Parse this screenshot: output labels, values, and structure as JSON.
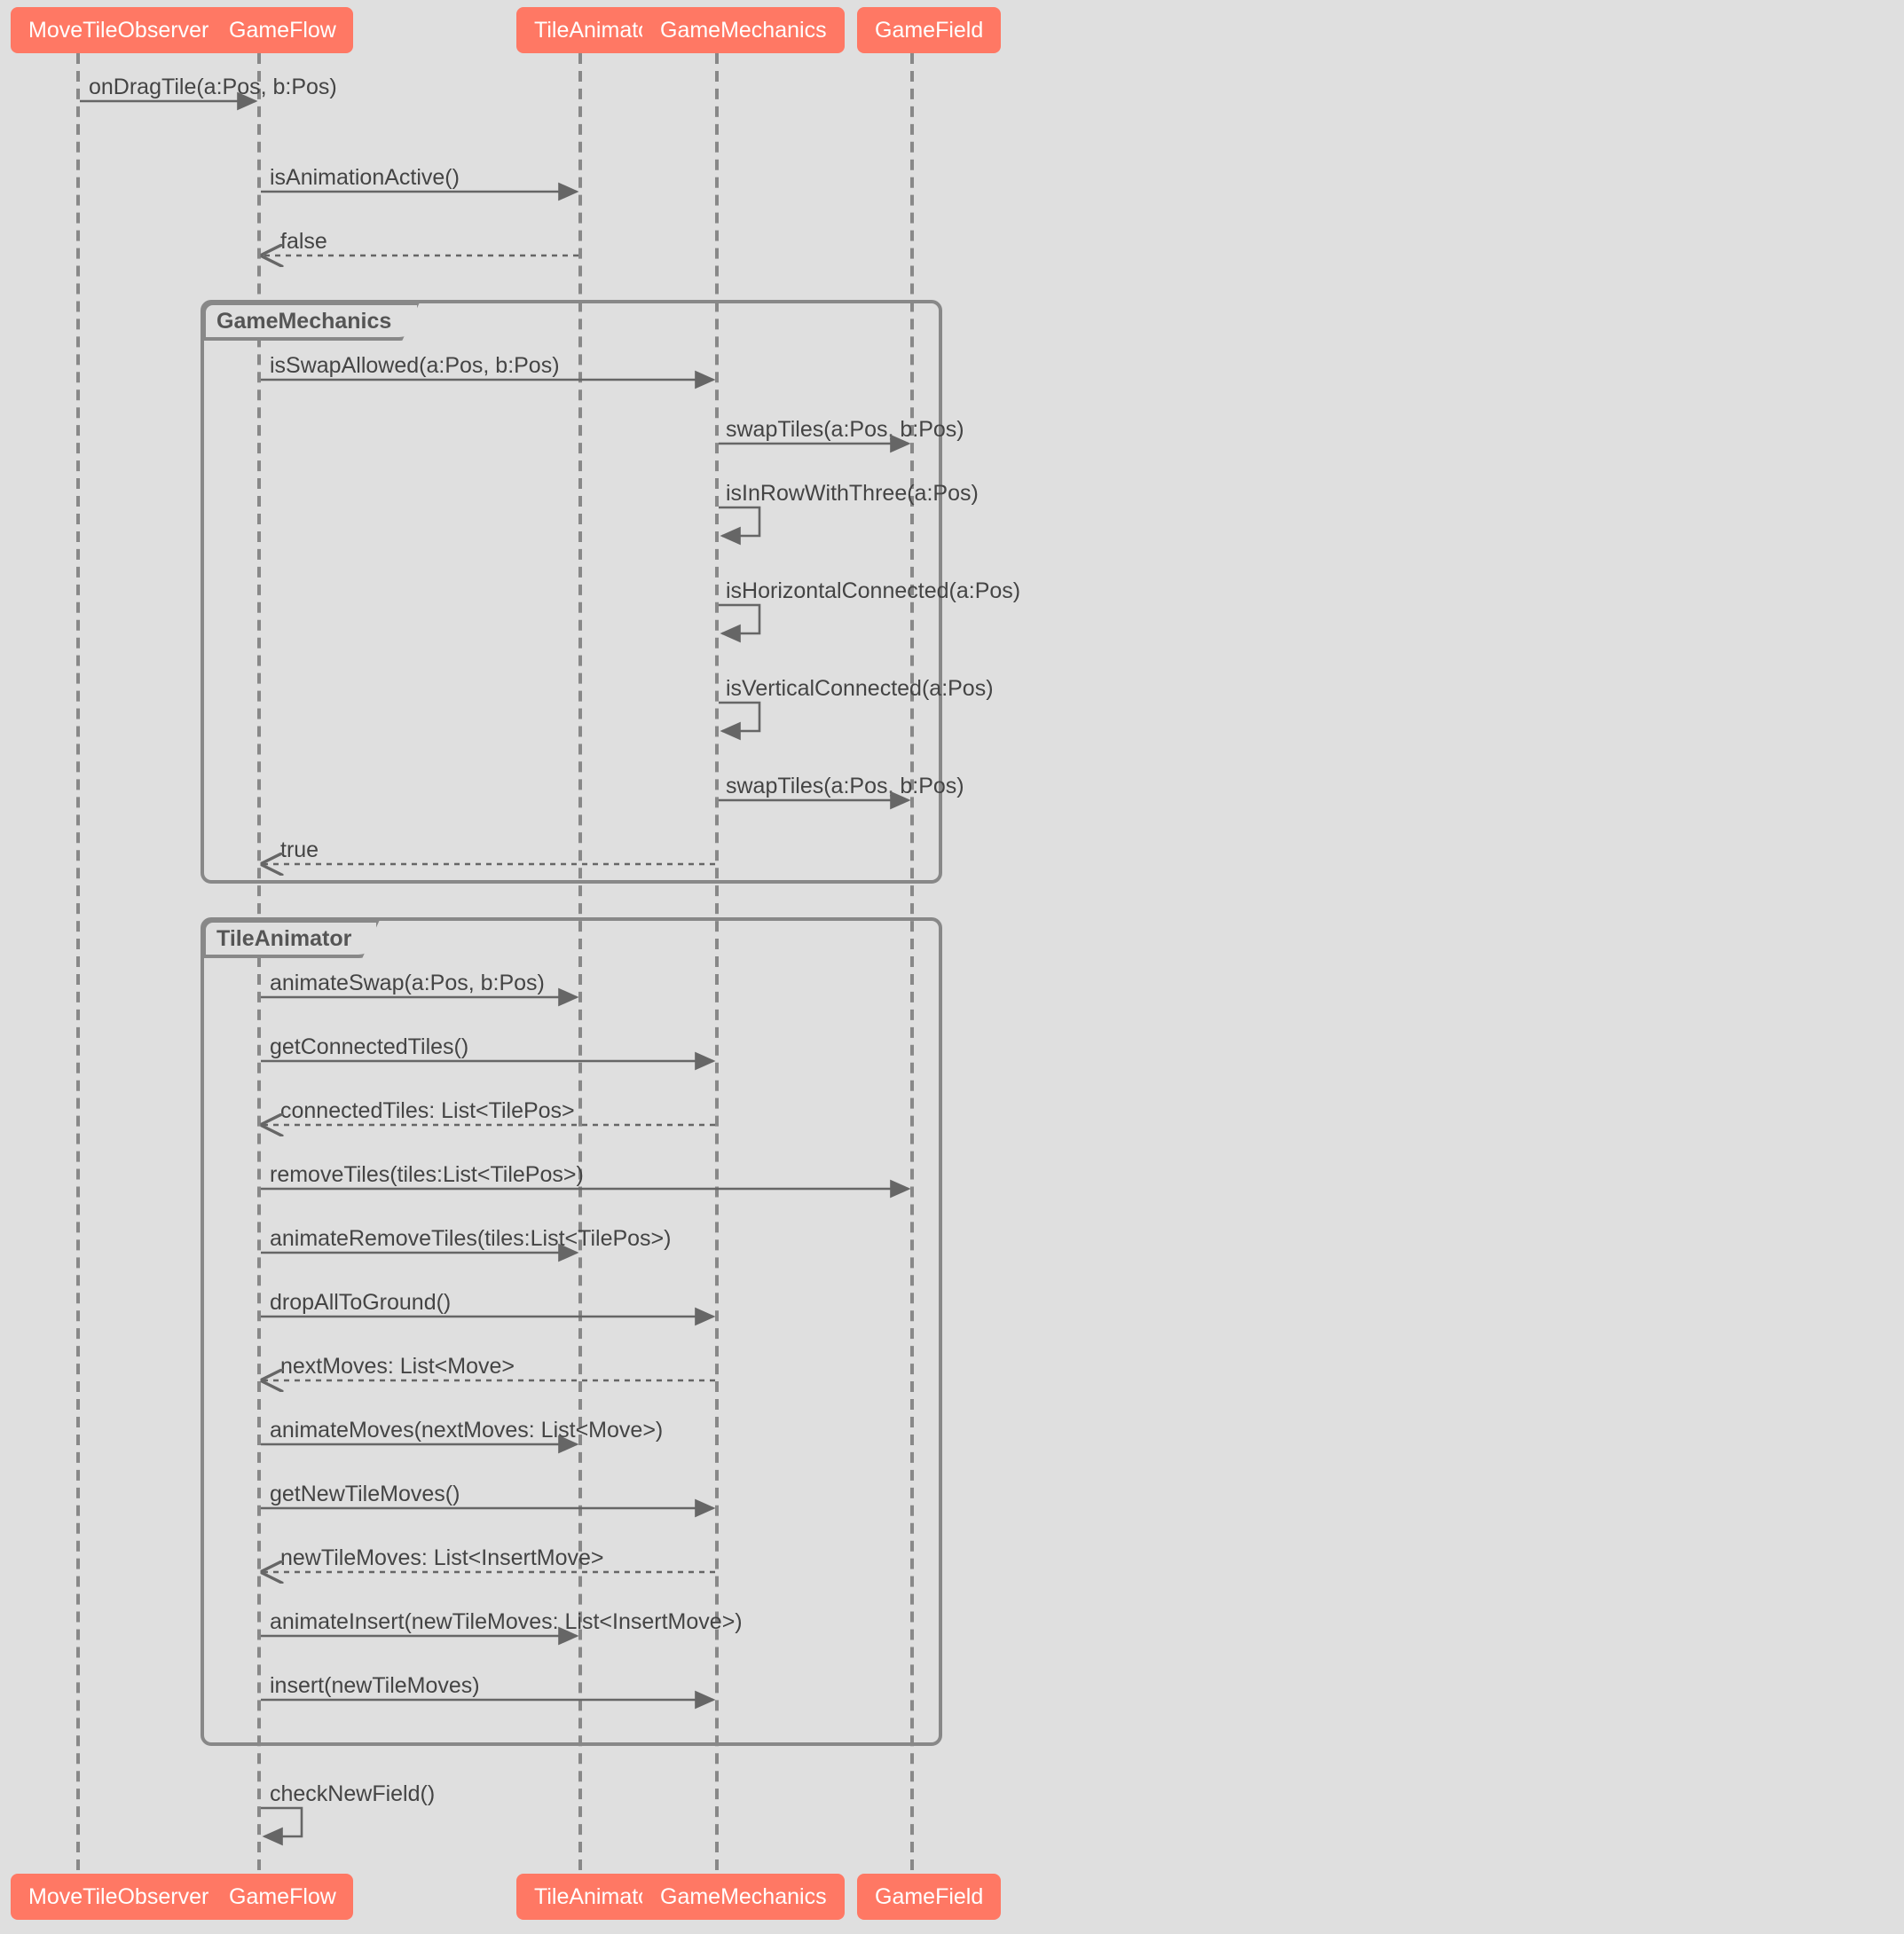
{
  "participants": {
    "p0": "MoveTileObserver",
    "p1": "GameFlow",
    "p2": "TileAnimator",
    "p3": "GameMechanics",
    "p4": "GameField"
  },
  "frames": {
    "f0": "GameMechanics",
    "f1": "TileAnimator"
  },
  "messages": {
    "m0": "onDragTile(a:Pos, b:Pos)",
    "m1": "isAnimationActive()",
    "m2": "false",
    "m3": "isSwapAllowed(a:Pos, b:Pos)",
    "m4": "swapTiles(a:Pos, b:Pos)",
    "m5": "isInRowWithThree(a:Pos)",
    "m6": "isHorizontalConnected(a:Pos)",
    "m7": "isVerticalConnected(a:Pos)",
    "m8": "swapTiles(a:Pos, b:Pos)",
    "m9": "true",
    "m10": "animateSwap(a:Pos, b:Pos)",
    "m11": "getConnectedTiles()",
    "m12": "connectedTiles: List<TilePos>",
    "m13": "removeTiles(tiles:List<TilePos>)",
    "m14": "animateRemoveTiles(tiles:List<TilePos>)",
    "m15": "dropAllToGround()",
    "m16": "nextMoves: List<Move>",
    "m17": "animateMoves(nextMoves: List<Move>)",
    "m18": "getNewTileMoves()",
    "m19": "newTileMoves: List<InsertMove>",
    "m20": "animateInsert(newTileMoves: List<InsertMove>)",
    "m21": "insert(newTileMoves)",
    "m22": "checkNewField()"
  },
  "chart_data": {
    "type": "uml-sequence",
    "participants": [
      "MoveTileObserver",
      "GameFlow",
      "TileAnimator",
      "GameMechanics",
      "GameField"
    ],
    "messages": [
      {
        "from": "MoveTileObserver",
        "to": "GameFlow",
        "label": "onDragTile(a:Pos, b:Pos)",
        "kind": "call"
      },
      {
        "from": "GameFlow",
        "to": "TileAnimator",
        "label": "isAnimationActive()",
        "kind": "call"
      },
      {
        "from": "TileAnimator",
        "to": "GameFlow",
        "label": "false",
        "kind": "return"
      },
      {
        "frame": "GameMechanics",
        "messages": [
          {
            "from": "GameFlow",
            "to": "GameMechanics",
            "label": "isSwapAllowed(a:Pos, b:Pos)",
            "kind": "call"
          },
          {
            "from": "GameMechanics",
            "to": "GameField",
            "label": "swapTiles(a:Pos, b:Pos)",
            "kind": "call"
          },
          {
            "from": "GameMechanics",
            "to": "GameMechanics",
            "label": "isInRowWithThree(a:Pos)",
            "kind": "self"
          },
          {
            "from": "GameMechanics",
            "to": "GameMechanics",
            "label": "isHorizontalConnected(a:Pos)",
            "kind": "self"
          },
          {
            "from": "GameMechanics",
            "to": "GameMechanics",
            "label": "isVerticalConnected(a:Pos)",
            "kind": "self"
          },
          {
            "from": "GameMechanics",
            "to": "GameField",
            "label": "swapTiles(a:Pos, b:Pos)",
            "kind": "call"
          },
          {
            "from": "GameMechanics",
            "to": "GameFlow",
            "label": "true",
            "kind": "return"
          }
        ]
      },
      {
        "frame": "TileAnimator",
        "messages": [
          {
            "from": "GameFlow",
            "to": "TileAnimator",
            "label": "animateSwap(a:Pos, b:Pos)",
            "kind": "call"
          },
          {
            "from": "GameFlow",
            "to": "GameMechanics",
            "label": "getConnectedTiles()",
            "kind": "call"
          },
          {
            "from": "GameMechanics",
            "to": "GameFlow",
            "label": "connectedTiles: List<TilePos>",
            "kind": "return"
          },
          {
            "from": "GameFlow",
            "to": "GameField",
            "label": "removeTiles(tiles:List<TilePos>)",
            "kind": "call"
          },
          {
            "from": "GameFlow",
            "to": "TileAnimator",
            "label": "animateRemoveTiles(tiles:List<TilePos>)",
            "kind": "call"
          },
          {
            "from": "GameFlow",
            "to": "GameMechanics",
            "label": "dropAllToGround()",
            "kind": "call"
          },
          {
            "from": "GameMechanics",
            "to": "GameFlow",
            "label": "nextMoves: List<Move>",
            "kind": "return"
          },
          {
            "from": "GameFlow",
            "to": "TileAnimator",
            "label": "animateMoves(nextMoves: List<Move>)",
            "kind": "call"
          },
          {
            "from": "GameFlow",
            "to": "GameMechanics",
            "label": "getNewTileMoves()",
            "kind": "call"
          },
          {
            "from": "GameMechanics",
            "to": "GameFlow",
            "label": "newTileMoves: List<InsertMove>",
            "kind": "return"
          },
          {
            "from": "GameFlow",
            "to": "TileAnimator",
            "label": "animateInsert(newTileMoves: List<InsertMove>)",
            "kind": "call"
          },
          {
            "from": "GameFlow",
            "to": "GameMechanics",
            "label": "insert(newTileMoves)",
            "kind": "call"
          }
        ]
      },
      {
        "from": "GameFlow",
        "to": "GameFlow",
        "label": "checkNewField()",
        "kind": "self"
      }
    ]
  }
}
